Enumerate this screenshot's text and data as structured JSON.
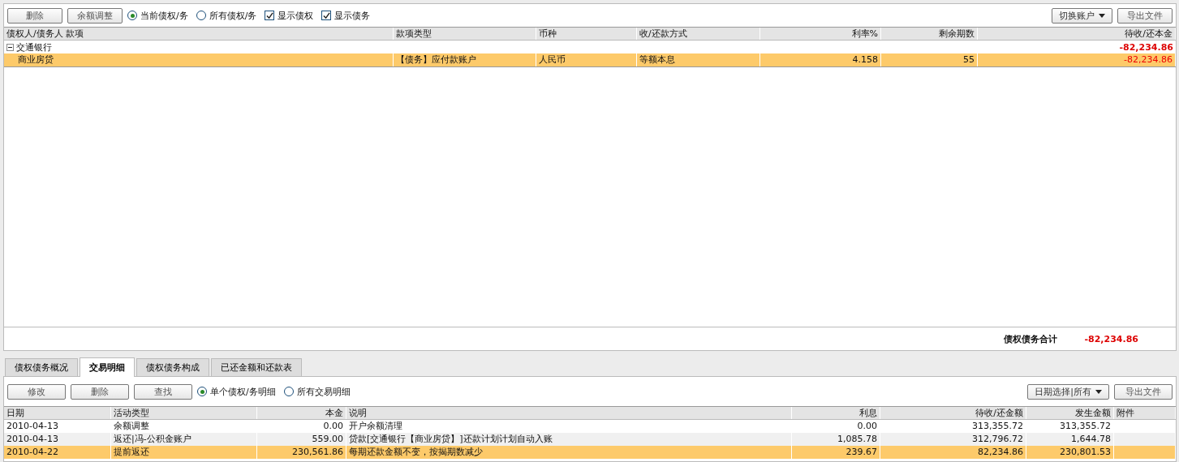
{
  "top_toolbar": {
    "buttons": [
      "删除",
      "余额调整"
    ],
    "radios": [
      {
        "label": "当前债权/务",
        "selected": true
      },
      {
        "label": "所有债权/务",
        "selected": false
      }
    ],
    "checkboxes": [
      {
        "label": "显示债权",
        "checked": true
      },
      {
        "label": "显示债务",
        "checked": true
      }
    ],
    "right_buttons": [
      {
        "label": "切换账户",
        "kind": "dropdown"
      },
      {
        "label": "导出文件",
        "kind": "button"
      }
    ]
  },
  "accounts_table": {
    "columns": [
      "债权人/债务人 款项",
      "款项类型",
      "币种",
      "收/还款方式",
      "利率%",
      "剩余期数",
      "待收/还本金"
    ],
    "groups": [
      {
        "name": "交通银行",
        "expanded": true,
        "amount": "-82,234.86",
        "rows": [
          {
            "selected": true,
            "cells": [
              "商业房贷",
              "【债务】应付款账户",
              "人民币",
              "等额本息",
              "4.158",
              "55",
              "-82,234.86"
            ]
          }
        ]
      }
    ]
  },
  "summary": {
    "label": "债权债务合计",
    "value": "-82,234.86"
  },
  "tabs": [
    {
      "label": "债权债务概况",
      "selected": false
    },
    {
      "label": "交易明细",
      "selected": true
    },
    {
      "label": "债权债务构成",
      "selected": false
    },
    {
      "label": "已还金额和还款表",
      "selected": false
    }
  ],
  "detail_toolbar": {
    "buttons": [
      "修改",
      "删除",
      "查找"
    ],
    "radios": [
      {
        "label": "单个债权/务明细",
        "selected": true
      },
      {
        "label": "所有交易明细",
        "selected": false
      }
    ],
    "right_buttons": [
      {
        "label": "日期选择|所有",
        "kind": "dropdown"
      },
      {
        "label": "导出文件",
        "kind": "button"
      }
    ]
  },
  "transactions_table": {
    "columns": [
      "日期",
      "活动类型",
      "本金",
      "说明",
      "利息",
      "待收/还金额",
      "发生金额",
      "附件"
    ],
    "rows": [
      {
        "selected": false,
        "cells": [
          "2010-04-13",
          "余额调整",
          "0.00",
          "开户余额清理",
          "0.00",
          "313,355.72",
          "313,355.72",
          ""
        ]
      },
      {
        "selected": false,
        "cells": [
          "2010-04-13",
          "返还|冯-公积金账户",
          "559.00",
          "贷款[交通银行【商业房贷】]还款计划计划自动入账",
          "1,085.78",
          "312,796.72",
          "1,644.78",
          ""
        ]
      },
      {
        "selected": true,
        "cells": [
          "2010-04-22",
          "提前返还",
          "230,561.86",
          "每期还款金额不变，按揭期数减少",
          "239.67",
          "82,234.86",
          "230,801.53",
          ""
        ]
      }
    ]
  }
}
